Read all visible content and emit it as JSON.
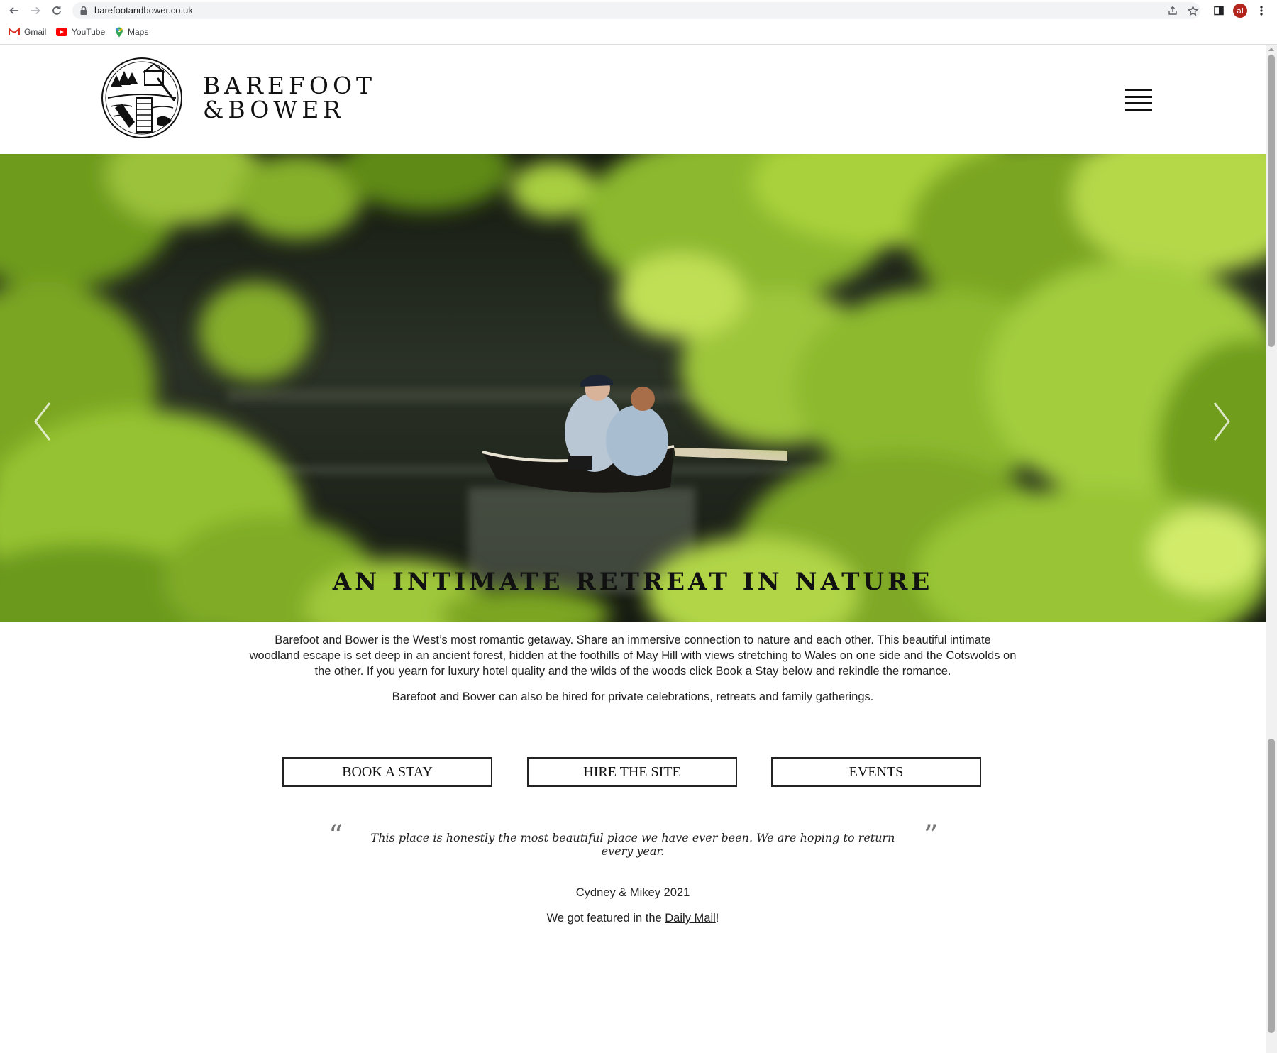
{
  "browser": {
    "url": "barefootandbower.co.uk",
    "bookmarks": [
      {
        "label": "Gmail",
        "icon": "gmail-icon"
      },
      {
        "label": "YouTube",
        "icon": "youtube-icon"
      },
      {
        "label": "Maps",
        "icon": "maps-icon"
      }
    ],
    "avatar_label": "ai"
  },
  "header": {
    "logo_line1": "BAREFOOT",
    "logo_line2": "&BOWER",
    "menu_icon": "hamburger-menu-icon"
  },
  "hero": {
    "image_description_icon": "canoe-photo",
    "prev_icon": "chevron-left-icon",
    "next_icon": "chevron-right-icon"
  },
  "main": {
    "headline": "AN INTIMATE RETREAT IN NATURE",
    "intro_p1": "Barefoot and Bower is the West’s most romantic getaway. Share an immersive connection to nature and each other. This beautiful intimate woodland escape is set deep in an ancient forest, hidden at the foothills of May Hill with views stretching to Wales on one side and the Cotswolds on the other. If you yearn for luxury hotel quality and the wilds of the woods click Book a Stay below and rekindle the romance.",
    "intro_p2": "Barefoot and Bower can also be hired for private celebrations, retreats and family gatherings.",
    "buttons": [
      "BOOK A STAY",
      "HIRE THE SITE",
      "EVENTS"
    ],
    "quote_open": "“",
    "quote_close": "”",
    "quote": "This place is honestly the most beautiful place we have ever been. We are hoping to return every year.",
    "attribution": "Cydney & Mikey 2021",
    "featured_prefix": "We got featured in the ",
    "featured_link": "Daily Mail",
    "featured_suffix": "!"
  },
  "colors": {
    "accent_dark": "#111111",
    "foliage_light": "#a9d13a",
    "foliage_dark": "#5c8a17",
    "water": "#1f2418"
  }
}
